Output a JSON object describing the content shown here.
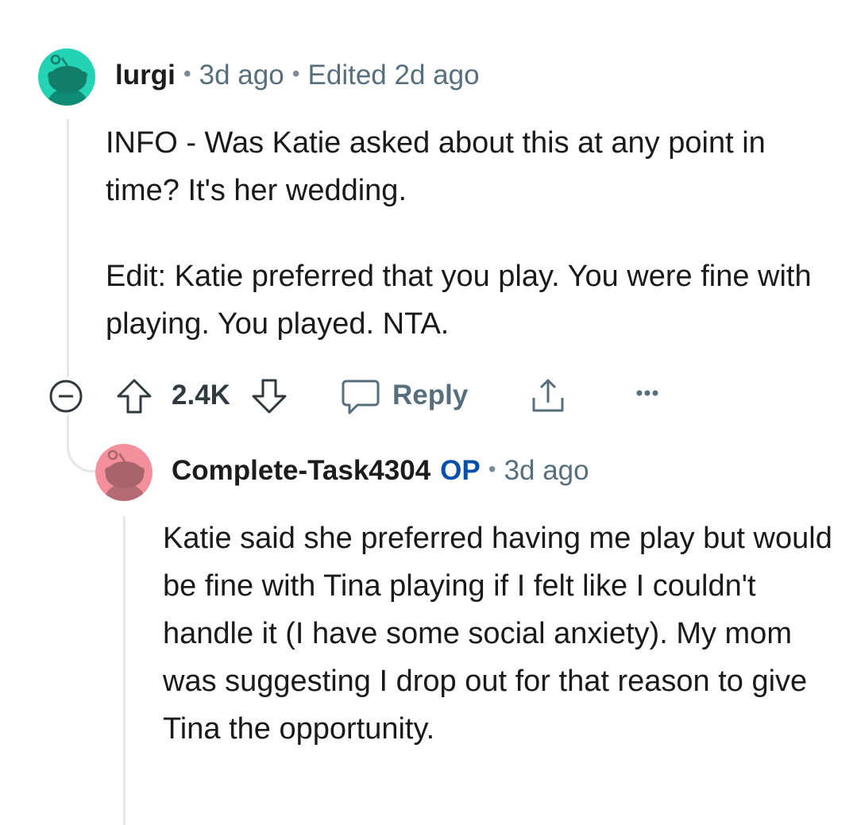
{
  "comment": {
    "author": "lurgi",
    "time": "3d ago",
    "edited": "Edited 2d ago",
    "body": [
      "INFO - Was Katie asked about this at any point in time? It's her wedding.",
      "Edit: Katie preferred that you play. You were fine with playing. You played. NTA."
    ],
    "votes": "2.4K",
    "reply_label": "Reply",
    "avatar_color": "#24d3b4",
    "icons": [
      "collapse-icon",
      "upvote-icon",
      "downvote-icon",
      "reply-icon",
      "share-icon",
      "more-icon"
    ]
  },
  "reply": {
    "author": "Complete-Task4304",
    "op_badge": "OP",
    "time": "3d ago",
    "body": "Katie said she preferred having me play but would be fine with Tina playing if I felt like I couldn't handle it (I have some social anxiety). My mom was suggesting I drop out for that reason to give Tina the opportunity.",
    "avatar_color": "#f4909c"
  },
  "colors": {
    "meta_text": "#576f7d",
    "op_badge": "#0a4fa8",
    "thread_line": "#e4e6e8"
  }
}
